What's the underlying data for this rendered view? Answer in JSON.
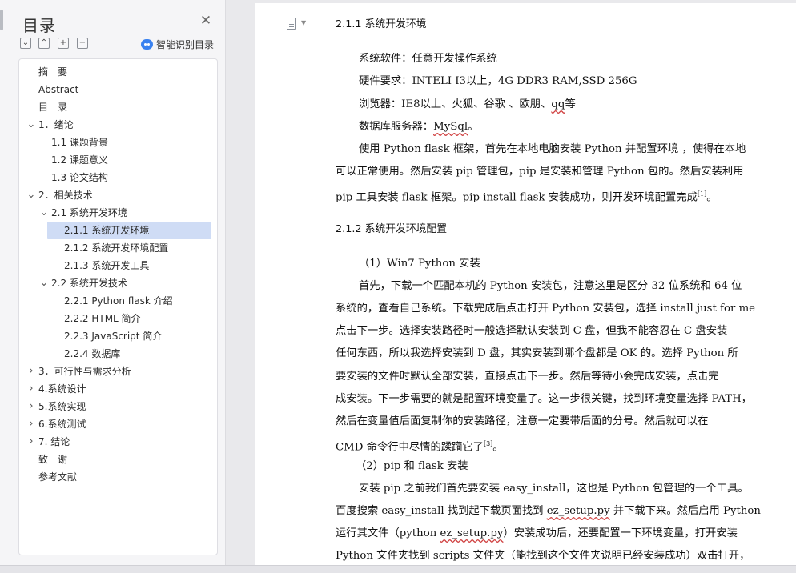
{
  "nav": {
    "title": "目录",
    "close_icon": "close-icon",
    "smart_toc_label": "智能识别目录",
    "toolbar": [
      "collapse-all-icon",
      "expand-level-icon",
      "add-heading-icon",
      "remove-heading-icon"
    ],
    "items": [
      {
        "label": "摘　要",
        "level": 1,
        "expander": "none"
      },
      {
        "label": "Abstract",
        "level": 1,
        "expander": "none"
      },
      {
        "label": "目　录",
        "level": 1,
        "expander": "none"
      },
      {
        "label": "1．绪论",
        "level": 1,
        "expander": "expanded"
      },
      {
        "label": "1.1  课题背景",
        "level": 2,
        "expander": "none"
      },
      {
        "label": "1.2  课题意义",
        "level": 2,
        "expander": "none"
      },
      {
        "label": "1.3  论文结构",
        "level": 2,
        "expander": "none"
      },
      {
        "label": "2．相关技术",
        "level": 1,
        "expander": "expanded"
      },
      {
        "label": "2.1  系统开发环境",
        "level": 2,
        "expander": "expanded"
      },
      {
        "label": "2.1.1 系统开发环境",
        "level": 3,
        "expander": "none",
        "selected": true
      },
      {
        "label": "2.1.2 系统开发环境配置",
        "level": 3,
        "expander": "none"
      },
      {
        "label": "2.1.3 系统开发工具",
        "level": 3,
        "expander": "none"
      },
      {
        "label": "2.2  系统开发技术",
        "level": 2,
        "expander": "expanded"
      },
      {
        "label": "2.2.1 Python flask 介绍",
        "level": 3,
        "expander": "none"
      },
      {
        "label": "2.2.2 HTML 简介",
        "level": 3,
        "expander": "none"
      },
      {
        "label": "2.2.3 JavaScript  简介",
        "level": 3,
        "expander": "none"
      },
      {
        "label": "2.2.4 数据库",
        "level": 3,
        "expander": "none"
      },
      {
        "label": "3．可行性与需求分析",
        "level": 1,
        "expander": "collapsed"
      },
      {
        "label": "4.系统设计",
        "level": 1,
        "expander": "collapsed"
      },
      {
        "label": "5.系统实现",
        "level": 1,
        "expander": "collapsed"
      },
      {
        "label": "6.系统测试",
        "level": 1,
        "expander": "collapsed"
      },
      {
        "label": "7. 结论",
        "level": 1,
        "expander": "collapsed"
      },
      {
        "label": "致　谢",
        "level": 1,
        "expander": "none"
      },
      {
        "label": "参考文献",
        "level": 1,
        "expander": "none"
      }
    ]
  },
  "document": {
    "lines": [
      {
        "text": "2.1.1 系统开发环境",
        "kind": "heading"
      },
      {
        "text": "系统软件：任意开发操作系统",
        "kind": "indent"
      },
      {
        "text": "硬件要求：INTELI I3以上，4G DDR3 RAM,SSD 256G",
        "kind": "indent"
      },
      {
        "text": "浏览器：IE8以上、火狐、谷歌 、欧朋、",
        "tail": "qq",
        "after": "等",
        "kind": "indent"
      },
      {
        "text": "数据库服务器：",
        "tail": "MySql",
        "after": "。",
        "kind": "indent"
      },
      {
        "text": "使用 Python flask 框架，首先在本地电脑安装 Python 并配置环境 ，使得在本地",
        "kind": "indent"
      },
      {
        "text": "可以正常使用。然后安装 pip 管理包，pip 是安装和管理 Python 包的。然后安装利用",
        "kind": "body"
      },
      {
        "text": "pip 工具安装 flask 框架。pip install flask 安装成功，则开发环境配置完成",
        "sup": "[1]",
        "after": "。",
        "kind": "body"
      },
      {
        "text": "2.1.2 系统开发环境配置",
        "kind": "heading"
      },
      {
        "text": "（1）Win7 Python  安装",
        "kind": "indent"
      },
      {
        "text": "首先，下载一个匹配本机的 Python 安装包，注意这里是区分 32 位系统和 64 位",
        "kind": "indent"
      },
      {
        "text": "系统的，查看自己系统。下载完成后点击打开 Python 安装包，选择 install just for me",
        "kind": "body"
      },
      {
        "text": "点击下一步。选择安装路径时一般选择默认安装到 C 盘，但我不能容忍在 C 盘安装",
        "kind": "body"
      },
      {
        "text": "任何东西，所以我选择安装到 D 盘，其实安装到哪个盘都是 OK 的。选择 Python 所",
        "kind": "body"
      },
      {
        "text": "要安装的文件时默认全部安装，直接点击下一步。然后等待小会完成安装，点击完",
        "kind": "body"
      },
      {
        "text": "成安装。下一步需要的就是配置环境变量了。这一步很关键，找到环境变量选择 PATH，",
        "kind": "body"
      },
      {
        "text": "然后在变量值后面复制你的安装路径，注意一定要带后面的分号。然后就可以在",
        "kind": "body"
      },
      {
        "text": "CMD 命令行中尽情的蹂躏它了",
        "sup": "[3]",
        "after": "。",
        "kind": "body"
      },
      {
        "text": "（2）pip 和 flask  安装",
        "kind": "indent2"
      },
      {
        "text": "安装 pip 之前我们首先要安装 easy_install，这也是 Python 包管理的一个工具。",
        "kind": "indent"
      },
      {
        "text": "百度搜索 easy_install 找到起下载页面找到 ",
        "tail": "ez_setup.py",
        "after": " 并下载下来。然后启用 Python",
        "kind": "body"
      },
      {
        "text": "运行其文件（python ",
        "tail": "ez_setup.py",
        "after": "）安装成功后，还要配置一下环境变量，打开安装",
        "kind": "body"
      },
      {
        "text": "Python 文件夹找到 scripts 文件夹（能找到这个文件夹说明已经安装成功）双击打开，",
        "kind": "body"
      }
    ]
  }
}
